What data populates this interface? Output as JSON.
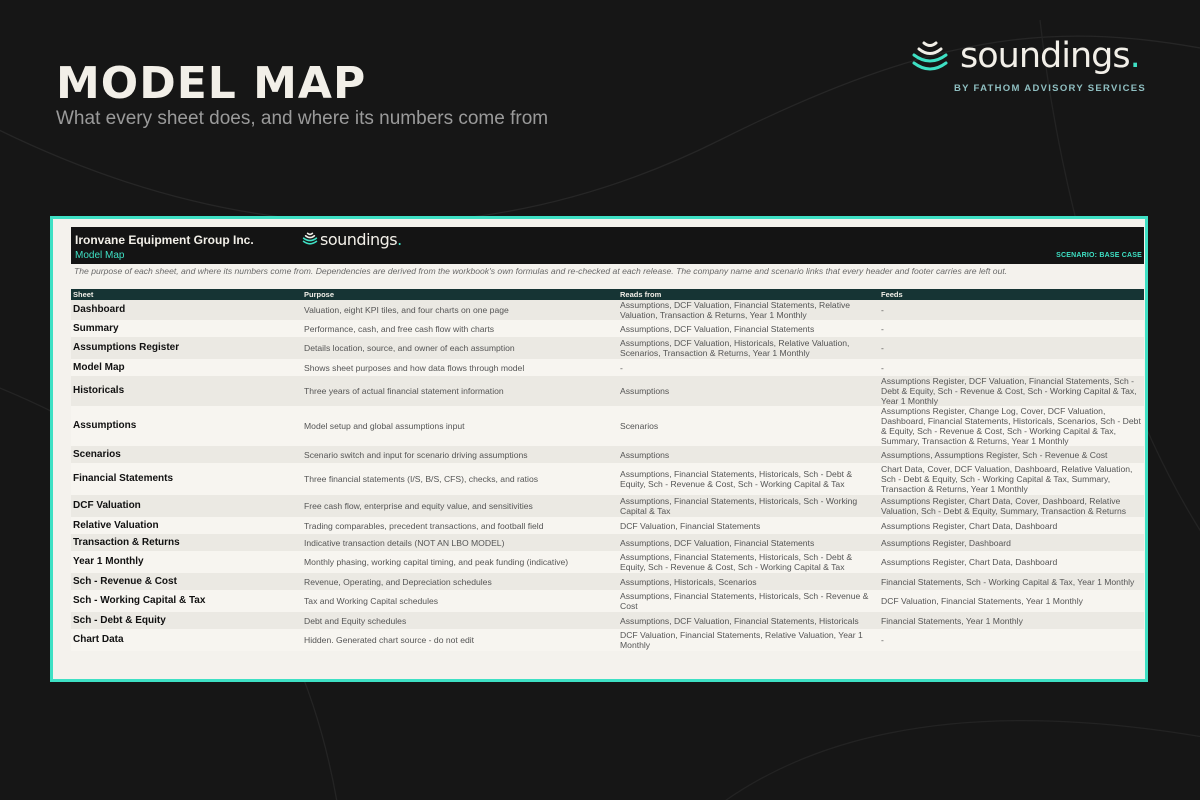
{
  "hero": {
    "title": "MODEL MAP",
    "subtitle": "What every sheet does, and where its numbers come from"
  },
  "brand": {
    "word": "soundings",
    "dot": ".",
    "tagline": "BY FATHOM ADVISORY SERVICES",
    "accent": "#3ee0c4"
  },
  "sheet": {
    "company": "Ironvane Equipment Group Inc.",
    "name": "Model Map",
    "brand_word": "soundings",
    "brand_dot": ".",
    "scenario": "SCENARIO: BASE CASE",
    "note": "The purpose of each sheet, and where its numbers come from. Dependencies are derived from the workbook's own formulas and re-checked at each release. The company name and scenario links that every header and footer carries are left out.",
    "columns": [
      "Sheet",
      "Purpose",
      "Reads from",
      "Feeds"
    ],
    "rows": [
      {
        "sheet": "Dashboard",
        "purpose": "Valuation, eight KPI tiles, and four charts on one page",
        "reads": "Assumptions, DCF Valuation, Financial Statements, Relative Valuation, Transaction & Returns, Year 1 Monthly",
        "feeds": "-"
      },
      {
        "sheet": "Summary",
        "purpose": "Performance, cash, and free cash flow with charts",
        "reads": "Assumptions, DCF Valuation, Financial Statements",
        "feeds": "-"
      },
      {
        "sheet": "Assumptions Register",
        "purpose": "Details location, source, and owner of each assumption",
        "reads": "Assumptions, DCF Valuation, Historicals, Relative Valuation, Scenarios, Transaction & Returns, Year 1 Monthly",
        "feeds": "-"
      },
      {
        "sheet": "Model Map",
        "purpose": "Shows sheet purposes and how data flows through model",
        "reads": "-",
        "feeds": "-"
      },
      {
        "sheet": "Historicals",
        "purpose": "Three years of actual financial statement information",
        "reads": "Assumptions",
        "feeds": "Assumptions Register, DCF Valuation, Financial Statements, Sch - Debt & Equity, Sch - Revenue & Cost, Sch - Working Capital & Tax, Year 1 Monthly"
      },
      {
        "sheet": "Assumptions",
        "purpose": "Model setup and global assumptions input",
        "reads": "Scenarios",
        "feeds": "Assumptions Register, Change Log, Cover, DCF Valuation, Dashboard, Financial Statements, Historicals, Scenarios, Sch - Debt & Equity, Sch - Revenue & Cost, Sch - Working Capital & Tax, Summary, Transaction & Returns, Year 1 Monthly"
      },
      {
        "sheet": "Scenarios",
        "purpose": "Scenario switch and input for scenario driving assumptions",
        "reads": "Assumptions",
        "feeds": "Assumptions, Assumptions Register, Sch - Revenue & Cost"
      },
      {
        "sheet": "Financial Statements",
        "purpose": "Three financial statements (I/S, B/S, CFS), checks, and ratios",
        "reads": "Assumptions, Financial Statements, Historicals, Sch - Debt & Equity, Sch - Revenue & Cost, Sch - Working Capital & Tax",
        "feeds": "Chart Data, Cover, DCF Valuation, Dashboard, Relative Valuation, Sch - Debt & Equity, Sch - Working Capital & Tax, Summary, Transaction & Returns, Year 1 Monthly"
      },
      {
        "sheet": "DCF Valuation",
        "purpose": "Free cash flow, enterprise and equity value, and sensitivities",
        "reads": "Assumptions, Financial Statements, Historicals, Sch - Working Capital & Tax",
        "feeds": "Assumptions Register, Chart Data, Cover, Dashboard, Relative Valuation, Sch - Debt & Equity, Summary, Transaction & Returns"
      },
      {
        "sheet": "Relative Valuation",
        "purpose": "Trading comparables, precedent transactions, and football field",
        "reads": "DCF Valuation, Financial Statements",
        "feeds": "Assumptions Register, Chart Data, Dashboard"
      },
      {
        "sheet": "Transaction & Returns",
        "purpose": "Indicative transaction details (NOT AN LBO MODEL)",
        "reads": "Assumptions, DCF Valuation, Financial Statements",
        "feeds": "Assumptions Register, Dashboard"
      },
      {
        "sheet": "Year 1 Monthly",
        "purpose": "Monthly phasing, working capital timing, and peak funding (indicative)",
        "reads": "Assumptions, Financial Statements, Historicals, Sch - Debt & Equity, Sch - Revenue & Cost, Sch - Working Capital & Tax",
        "feeds": "Assumptions Register, Chart Data, Dashboard"
      },
      {
        "sheet": "Sch - Revenue & Cost",
        "purpose": "Revenue, Operating, and Depreciation schedules",
        "reads": "Assumptions, Historicals, Scenarios",
        "feeds": "Financial Statements, Sch - Working Capital & Tax, Year 1 Monthly"
      },
      {
        "sheet": "Sch - Working Capital & Tax",
        "purpose": "Tax and Working Capital schedules",
        "reads": "Assumptions, Financial Statements, Historicals, Sch - Revenue & Cost",
        "feeds": "DCF Valuation, Financial Statements, Year 1 Monthly"
      },
      {
        "sheet": "Sch - Debt & Equity",
        "purpose": "Debt and Equity schedules",
        "reads": "Assumptions, DCF Valuation, Financial Statements, Historicals",
        "feeds": "Financial Statements, Year 1 Monthly"
      },
      {
        "sheet": "Chart Data",
        "purpose": "Hidden. Generated chart source - do not edit",
        "reads": "DCF Valuation, Financial Statements, Relative Valuation, Year 1 Monthly",
        "feeds": "-"
      }
    ]
  }
}
